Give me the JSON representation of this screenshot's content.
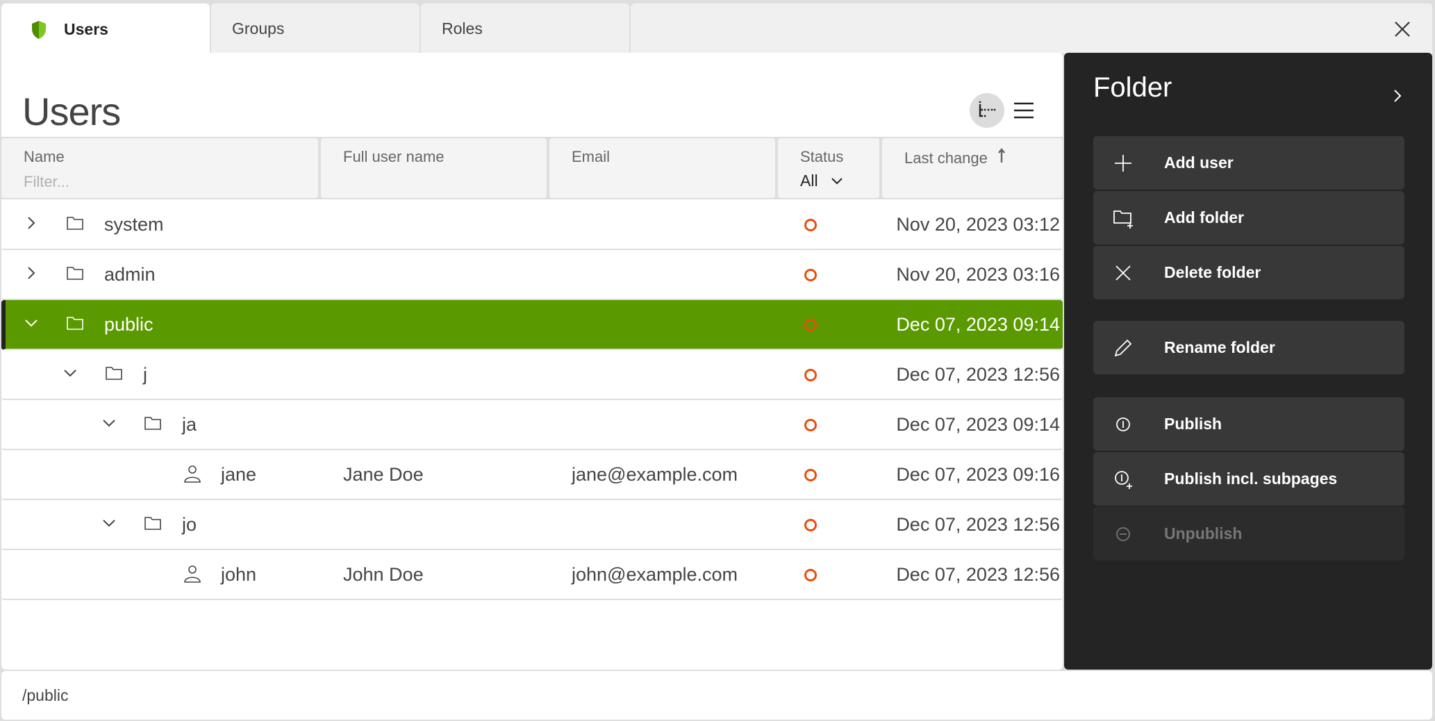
{
  "tabs": [
    {
      "label": "Users",
      "active": true,
      "icon": "shield-icon"
    },
    {
      "label": "Groups",
      "active": false
    },
    {
      "label": "Roles",
      "active": false
    }
  ],
  "close_icon": "close-icon",
  "brand_color": "#5a9a00",
  "main": {
    "title": "Users",
    "view_toggles": [
      "tree-view-icon",
      "list-view-icon"
    ],
    "columns": {
      "name": "Name",
      "name_filter_placeholder": "Filter...",
      "full_name": "Full user name",
      "email": "Email",
      "status": "Status",
      "status_filter": "All",
      "last_change": "Last change",
      "sort": "ascending"
    },
    "rows": [
      {
        "type": "folder",
        "depth": 0,
        "expanded": false,
        "name": "system",
        "full_name": "",
        "email": "",
        "status": "unpublished",
        "last_change": "Nov 20, 2023 03:12"
      },
      {
        "type": "folder",
        "depth": 0,
        "expanded": false,
        "name": "admin",
        "full_name": "",
        "email": "",
        "status": "unpublished",
        "last_change": "Nov 20, 2023 03:16"
      },
      {
        "type": "folder",
        "depth": 0,
        "expanded": true,
        "selected": true,
        "name": "public",
        "full_name": "",
        "email": "",
        "status": "unpublished",
        "last_change": "Dec 07, 2023 09:14"
      },
      {
        "type": "folder",
        "depth": 1,
        "expanded": true,
        "name": "j",
        "full_name": "",
        "email": "",
        "status": "unpublished",
        "last_change": "Dec 07, 2023 12:56"
      },
      {
        "type": "folder",
        "depth": 2,
        "expanded": true,
        "name": "ja",
        "full_name": "",
        "email": "",
        "status": "unpublished",
        "last_change": "Dec 07, 2023 09:14"
      },
      {
        "type": "user",
        "depth": 3,
        "name": "jane",
        "full_name": "Jane Doe",
        "email": "jane@example.com",
        "status": "unpublished",
        "last_change": "Dec 07, 2023 09:16"
      },
      {
        "type": "folder",
        "depth": 2,
        "expanded": true,
        "name": "jo",
        "full_name": "",
        "email": "",
        "status": "unpublished",
        "last_change": "Dec 07, 2023 12:56"
      },
      {
        "type": "user",
        "depth": 3,
        "name": "john",
        "full_name": "John Doe",
        "email": "john@example.com",
        "status": "unpublished",
        "last_change": "Dec 07, 2023 12:56"
      }
    ],
    "status_color": "#ea4d0b"
  },
  "side": {
    "title": "Folder",
    "actions": [
      {
        "label": "Add user",
        "icon": "plus-icon",
        "enabled": true
      },
      {
        "label": "Add folder",
        "icon": "add-folder-icon",
        "enabled": true
      },
      {
        "label": "Delete folder",
        "icon": "delete-icon",
        "enabled": true
      },
      {
        "label": "Rename folder",
        "icon": "pencil-icon",
        "enabled": true
      },
      {
        "label": "Publish",
        "icon": "publish-icon",
        "enabled": true
      },
      {
        "label": "Publish incl. subpages",
        "icon": "publish-subpages-icon",
        "enabled": true
      },
      {
        "label": "Unpublish",
        "icon": "unpublish-icon",
        "enabled": false
      }
    ]
  },
  "footer": {
    "path": "/public"
  }
}
